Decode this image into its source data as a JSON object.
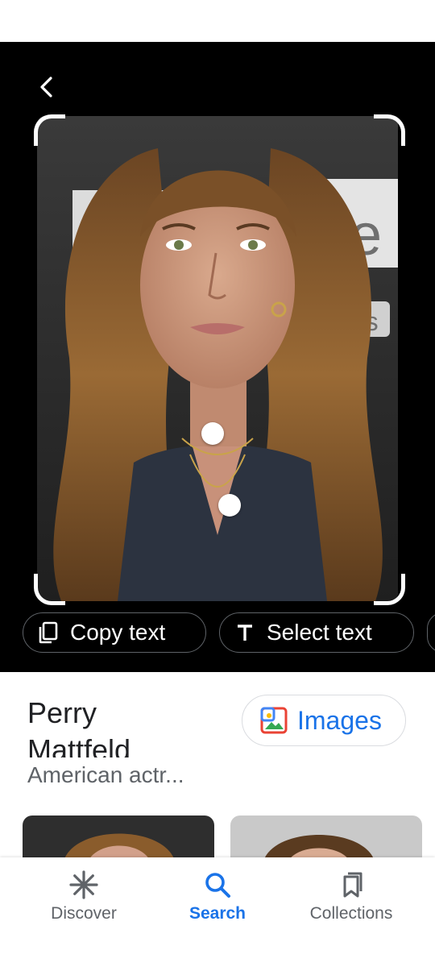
{
  "viewer": {
    "back_icon": "arrow-back-icon",
    "photo_signage": [
      "ele",
      "des"
    ],
    "chips": [
      {
        "label": "Copy text",
        "icon": "copy-icon"
      },
      {
        "label": "Select text",
        "icon": "text-select-icon"
      }
    ]
  },
  "result": {
    "title_line1": "Perry",
    "title_line2": "Mattfeld",
    "subtitle": "American actr...",
    "images_label": "Images",
    "images_icon": "image-icon"
  },
  "nav": {
    "items": [
      {
        "label": "Discover",
        "icon": "asterisk-icon",
        "active": false
      },
      {
        "label": "Search",
        "icon": "search-icon",
        "active": true
      },
      {
        "label": "Collections",
        "icon": "bookmarks-icon",
        "active": false
      }
    ],
    "active_color": "#1a73e8",
    "inactive_color": "#5f6368"
  }
}
